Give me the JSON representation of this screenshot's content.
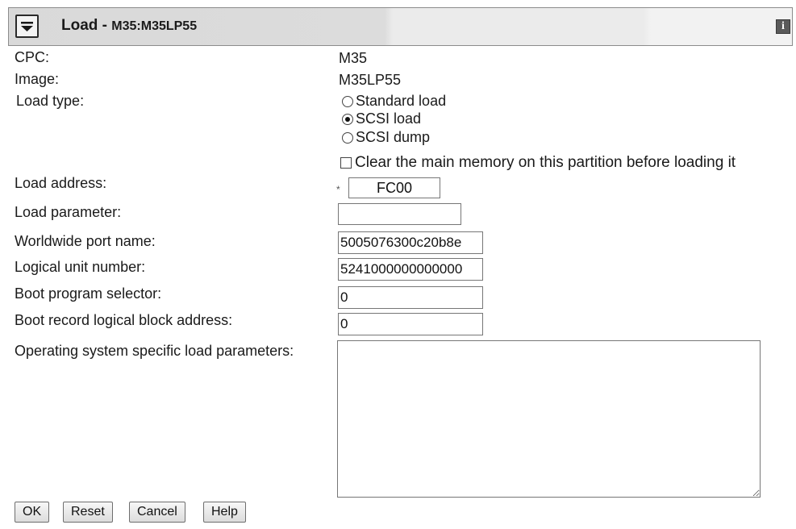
{
  "dialog": {
    "title": "Load -",
    "target": "M35:M35LP55",
    "info_icon": "info-icon",
    "menu_icon": "chevron-down-icon"
  },
  "fields": {
    "cpc": {
      "label": "CPC:",
      "value": "M35"
    },
    "image": {
      "label": "Image:",
      "value": "M35LP55"
    },
    "load_type": {
      "label": "Load type:",
      "options": [
        {
          "label": "Standard load",
          "selected": false
        },
        {
          "label": "SCSI load",
          "selected": true
        },
        {
          "label": "SCSI dump",
          "selected": false
        }
      ]
    },
    "clear_memory": {
      "label": "Clear the main memory on this partition before loading it",
      "checked": false
    },
    "load_address": {
      "label": "Load address:",
      "value": "FC00",
      "required_marker": "*"
    },
    "load_parameter": {
      "label": "Load parameter:",
      "value": ""
    },
    "wwpn": {
      "label": "Worldwide port name:",
      "value": "5005076300c20b8e"
    },
    "lun": {
      "label": "Logical unit number:",
      "value": "5241000000000000"
    },
    "boot_program_selector": {
      "label": "Boot program selector:",
      "value": "0"
    },
    "boot_record_lba": {
      "label": "Boot record logical block address:",
      "value": "0"
    },
    "os_load_parameters": {
      "label": "Operating system specific load parameters:",
      "value": ""
    }
  },
  "buttons": {
    "ok": "OK",
    "reset": "Reset",
    "cancel": "Cancel",
    "help": "Help"
  }
}
